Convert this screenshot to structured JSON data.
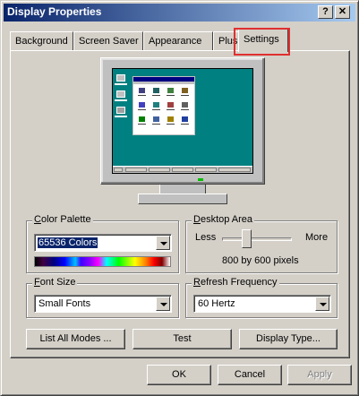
{
  "window": {
    "title": "Display Properties",
    "help_button": "?",
    "close_button": "✕"
  },
  "tabs": [
    {
      "label": "Background"
    },
    {
      "label": "Screen Saver"
    },
    {
      "label": "Appearance"
    },
    {
      "label": "Plus!"
    },
    {
      "label": "Settings",
      "selected": true
    }
  ],
  "settings": {
    "color_palette": {
      "label": "Color Palette",
      "accel": "C",
      "value": "65536 Colors"
    },
    "desktop_area": {
      "label": "Desktop Area",
      "accel": "D",
      "less": "Less",
      "more": "More",
      "value_text": "800 by 600 pixels",
      "slider_level": 0.35
    },
    "font_size": {
      "label": "Font Size",
      "accel": "F",
      "value": "Small Fonts"
    },
    "refresh_frequency": {
      "label": "Refresh Frequency",
      "accel": "R",
      "value": "60 Hertz"
    },
    "buttons": {
      "list_all_modes": "List All Modes ...",
      "test": "Test",
      "display_type": "Display Type..."
    }
  },
  "dialog_buttons": {
    "ok": "OK",
    "cancel": "Cancel",
    "apply": "Apply",
    "apply_enabled": false
  },
  "colors": {
    "title_start": "#0a246a",
    "title_end": "#a6caf0",
    "desktop": "#008080",
    "highlight": "#e03030"
  }
}
